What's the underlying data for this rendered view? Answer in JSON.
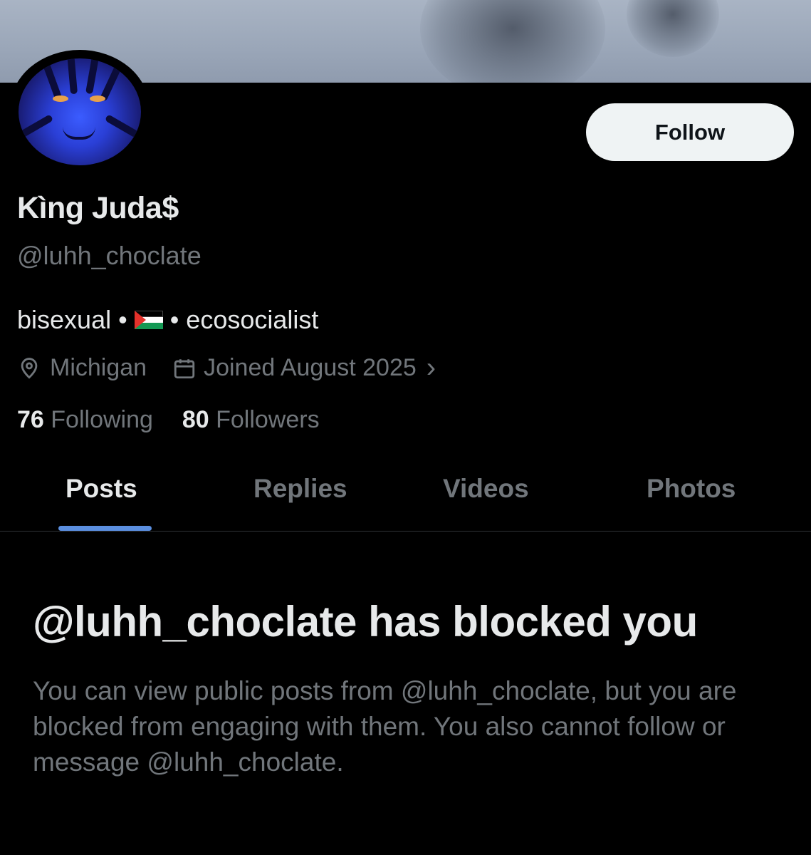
{
  "profile": {
    "display_name": "Kìng Juda$",
    "handle": "@luhh_choclate",
    "bio_part1": "bisexual •",
    "bio_flag": "palestine-flag-icon",
    "bio_part2": "• ecosocialist",
    "location": "Michigan",
    "joined": "Joined August 2025",
    "joined_chevron": "›",
    "following_count": "76",
    "following_label": "Following",
    "followers_count": "80",
    "followers_label": "Followers"
  },
  "actions": {
    "follow_label": "Follow"
  },
  "tabs": [
    {
      "label": "Posts",
      "active": true
    },
    {
      "label": "Replies",
      "active": false
    },
    {
      "label": "Videos",
      "active": false
    },
    {
      "label": "Photos",
      "active": false
    }
  ],
  "blocked": {
    "title": "@luhh_choclate has blocked you",
    "description": "You can view public posts from @luhh_choclate, but you are blocked from engaging with them. You also cannot follow or message @luhh_choclate."
  },
  "colors": {
    "background": "#000000",
    "text_primary": "#e7e9ea",
    "text_secondary": "#71767b",
    "accent": "#5b8fe0",
    "follow_button_bg": "#eff3f4"
  }
}
